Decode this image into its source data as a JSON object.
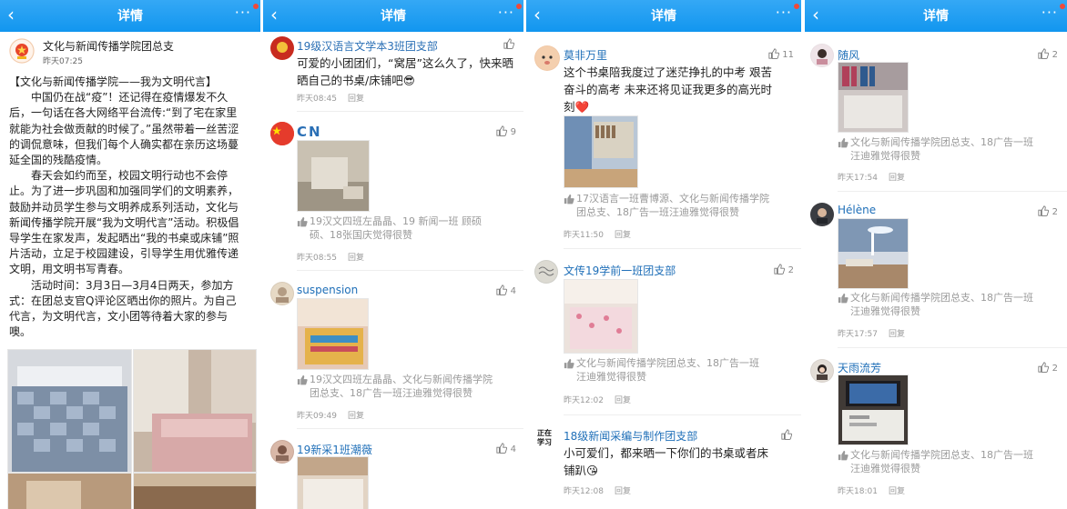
{
  "app": {
    "header_title": "详情",
    "back_glyph": "‹",
    "more_glyph": "···"
  },
  "panel1": {
    "author": "文化与新闻传播学院团总支",
    "time": "昨天07:25",
    "body": [
      "【文化与新闻传播学院——我为文明代言】",
      "　　中国仍在战“疫”！还记得在疫情爆发不久",
      "后，一句话在各大网络平台流传:“到了宅在家里",
      "就能为社会做贡献的时候了。”虽然带着一丝苦涩",
      "的调侃意味，但我们每个人确实都在亲历这场蔓",
      "延全国的残酷疫情。",
      "　　春天会如约而至，校园文明行动也不会停",
      "止。为了进一步巩固和加强同学们的文明素养，",
      "鼓励并动员学生参与文明养成系列活动，文化与",
      "新闻传播学院开展“我为文明代言”活动。积极倡",
      "导学生在家发声，发起晒出“我的书桌或床铺”照",
      "片活动，立足于校园建设，引导学生用优雅传递",
      "文明，用文明书写青春。",
      "　　活动时间：3月3日—3月4日两天，参加方",
      "式：在团总支官Q评论区晒出你的照片。为自己",
      "代言，为文明代言，文小团等待着大家的参与",
      "噢。"
    ]
  },
  "panel2": {
    "comments": [
      {
        "name": "19级汉语言文学本3班团支部",
        "text": [
          "可爱的小团团们，“窝居”这么久了，快来晒",
          "晒自己的书桌/床铺吧😎"
        ],
        "time": "昨天08:45",
        "reply": "回复",
        "likes": ""
      },
      {
        "name": "CN",
        "likedby": [
          "19汉文四班左晶晶、19 新闻一班 顾硕",
          "硕、18张国庆觉得很赞"
        ],
        "time": "昨天08:55",
        "reply": "回复",
        "likes": "9"
      },
      {
        "name": "suspension",
        "likedby": [
          "19汉文四班左晶晶、文化与新闻传播学院",
          "团总支、18广告一班汪迪雅觉得很赞"
        ],
        "time": "昨天09:49",
        "reply": "回复",
        "likes": "4"
      },
      {
        "name": "19新采1班潮薇",
        "likes": "4"
      }
    ]
  },
  "panel3": {
    "comments": [
      {
        "name": "莫非万里",
        "text": [
          "这个书桌陪我度过了迷茫挣扎的中考 艰苦",
          "奋斗的高考 未来还将见证我更多的高光时",
          "刻❤️"
        ],
        "likedby": [
          "17汉语言一班曹博源、文化与新闻传播学院",
          "团总支、18广告一班汪迪雅觉得很赞"
        ],
        "time": "昨天11:50",
        "reply": "回复",
        "likes": "11"
      },
      {
        "name": "文传19学前一班团支部",
        "likedby": [
          "文化与新闻传播学院团总支、18广告一班",
          "汪迪雅觉得很赞"
        ],
        "time": "昨天12:02",
        "reply": "回复",
        "likes": "2"
      },
      {
        "name": "18级新闻采编与制作团支部",
        "avatar_text": "正在学习",
        "text": [
          "小可爱们，都来晒一下你们的书桌或者床",
          "铺趴😘"
        ],
        "time": "昨天12:08",
        "reply": "回复",
        "likes": ""
      }
    ]
  },
  "panel4": {
    "comments": [
      {
        "name": "随风",
        "likedby": [
          "文化与新闻传播学院团总支、18广告一班",
          "汪迪雅觉得很赞"
        ],
        "time": "昨天17:54",
        "reply": "回复",
        "likes": "2"
      },
      {
        "name": "Hélène",
        "likedby": [
          "文化与新闻传播学院团总支、18广告一班",
          "汪迪雅觉得很赞"
        ],
        "time": "昨天17:57",
        "reply": "回复",
        "likes": "2"
      },
      {
        "name": "天雨流芳",
        "likedby": [
          "文化与新闻传播学院团总支、18广告一班",
          "汪迪雅觉得很赞"
        ],
        "time": "昨天18:01",
        "reply": "回复",
        "likes": "2"
      }
    ]
  },
  "colors": {
    "header": "#1296ef",
    "name": "#1f6fb8",
    "meta": "#999999"
  }
}
